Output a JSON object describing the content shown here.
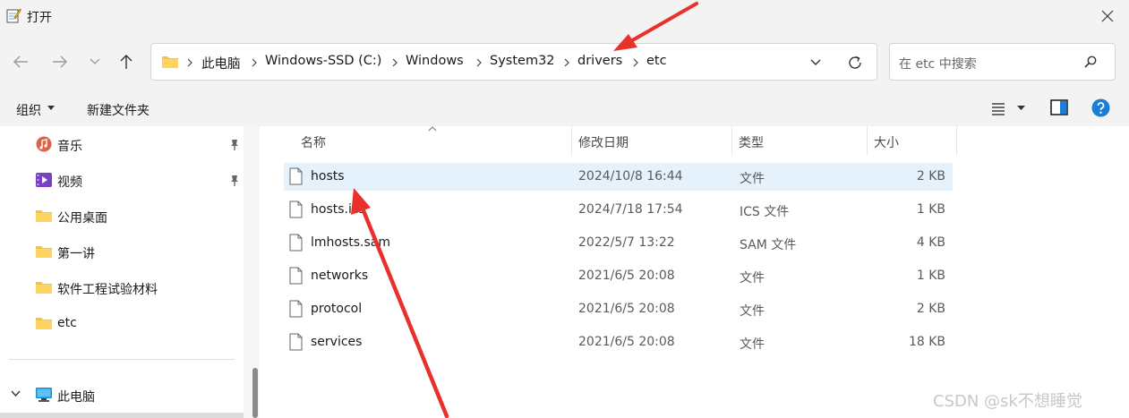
{
  "window": {
    "title": "打开"
  },
  "address": {
    "crumbs": [
      "此电脑",
      "Windows-SSD (C:)",
      "Windows",
      "System32",
      "drivers",
      "etc"
    ]
  },
  "search": {
    "placeholder": "在 etc 中搜索"
  },
  "toolbar": {
    "organize": "组织",
    "new_folder": "新建文件夹"
  },
  "sidebar": {
    "items": [
      {
        "label": "音乐"
      },
      {
        "label": "视频"
      },
      {
        "label": "公用桌面"
      },
      {
        "label": "第一讲"
      },
      {
        "label": "软件工程试验材料"
      },
      {
        "label": "etc"
      }
    ],
    "this_pc": "此电脑"
  },
  "columns": {
    "name": "名称",
    "modified": "修改日期",
    "type": "类型",
    "size": "大小"
  },
  "files": [
    {
      "name": "hosts",
      "modified": "2024/10/8 16:44",
      "type": "文件",
      "size": "2 KB"
    },
    {
      "name": "hosts.ics",
      "modified": "2024/7/18 17:54",
      "type": "ICS 文件",
      "size": "1 KB"
    },
    {
      "name": "lmhosts.sam",
      "modified": "2022/5/7 13:22",
      "type": "SAM 文件",
      "size": "4 KB"
    },
    {
      "name": "networks",
      "modified": "2021/6/5 20:08",
      "type": "文件",
      "size": "1 KB"
    },
    {
      "name": "protocol",
      "modified": "2021/6/5 20:08",
      "type": "文件",
      "size": "2 KB"
    },
    {
      "name": "services",
      "modified": "2021/6/5 20:08",
      "type": "文件",
      "size": "18 KB"
    }
  ],
  "watermark": "CSDN @sk不想睡觉",
  "colors": {
    "selection": "#e5f1fb",
    "accent": "#0067c0",
    "folder": "#f8c43e",
    "arrow": "#e8312a"
  }
}
